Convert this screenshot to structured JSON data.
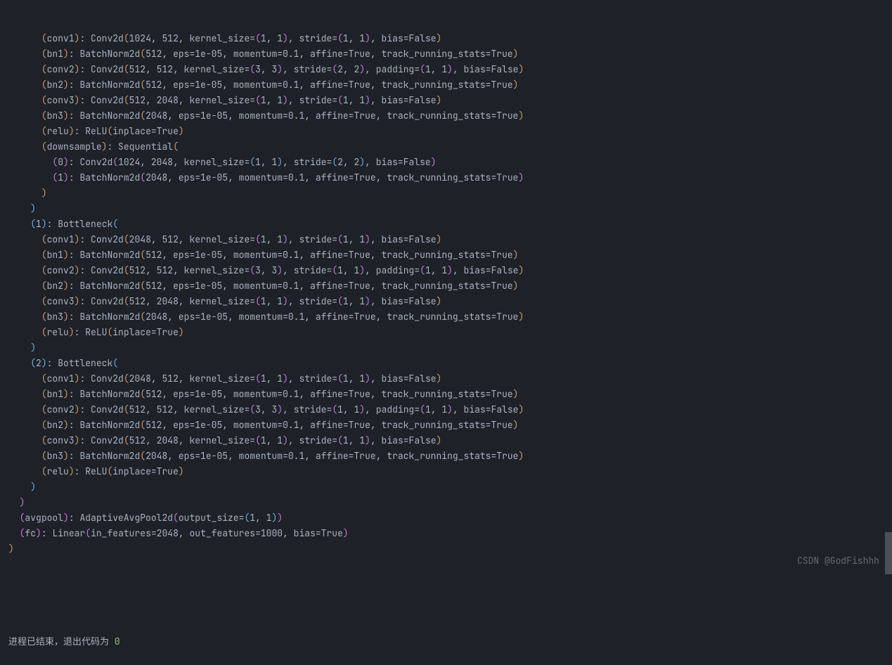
{
  "code_lines": [
    "      (conv1): Conv2d(1024, 512, kernel_size=(1, 1), stride=(1, 1), bias=False)",
    "      (bn1): BatchNorm2d(512, eps=1e-05, momentum=0.1, affine=True, track_running_stats=True)",
    "      (conv2): Conv2d(512, 512, kernel_size=(3, 3), stride=(2, 2), padding=(1, 1), bias=False)",
    "      (bn2): BatchNorm2d(512, eps=1e-05, momentum=0.1, affine=True, track_running_stats=True)",
    "      (conv3): Conv2d(512, 2048, kernel_size=(1, 1), stride=(1, 1), bias=False)",
    "      (bn3): BatchNorm2d(2048, eps=1e-05, momentum=0.1, affine=True, track_running_stats=True)",
    "      (relu): ReLU(inplace=True)",
    "      (downsample): Sequential(",
    "        (0): Conv2d(1024, 2048, kernel_size=(1, 1), stride=(2, 2), bias=False)",
    "        (1): BatchNorm2d(2048, eps=1e-05, momentum=0.1, affine=True, track_running_stats=True)",
    "      )",
    "    )",
    "    (1): Bottleneck(",
    "      (conv1): Conv2d(2048, 512, kernel_size=(1, 1), stride=(1, 1), bias=False)",
    "      (bn1): BatchNorm2d(512, eps=1e-05, momentum=0.1, affine=True, track_running_stats=True)",
    "      (conv2): Conv2d(512, 512, kernel_size=(3, 3), stride=(1, 1), padding=(1, 1), bias=False)",
    "      (bn2): BatchNorm2d(512, eps=1e-05, momentum=0.1, affine=True, track_running_stats=True)",
    "      (conv3): Conv2d(512, 2048, kernel_size=(1, 1), stride=(1, 1), bias=False)",
    "      (bn3): BatchNorm2d(2048, eps=1e-05, momentum=0.1, affine=True, track_running_stats=True)",
    "      (relu): ReLU(inplace=True)",
    "    )",
    "    (2): Bottleneck(",
    "      (conv1): Conv2d(2048, 512, kernel_size=(1, 1), stride=(1, 1), bias=False)",
    "      (bn1): BatchNorm2d(512, eps=1e-05, momentum=0.1, affine=True, track_running_stats=True)",
    "      (conv2): Conv2d(512, 512, kernel_size=(3, 3), stride=(1, 1), padding=(1, 1), bias=False)",
    "      (bn2): BatchNorm2d(512, eps=1e-05, momentum=0.1, affine=True, track_running_stats=True)",
    "      (conv3): Conv2d(512, 2048, kernel_size=(1, 1), stride=(1, 1), bias=False)",
    "      (bn3): BatchNorm2d(2048, eps=1e-05, momentum=0.1, affine=True, track_running_stats=True)",
    "      (relu): ReLU(inplace=True)",
    "    )",
    "  )",
    "  (avgpool): AdaptiveAvgPool2d(output_size=(1, 1))",
    "  (fc): Linear(in_features=2048, out_features=1000, bias=True)",
    ")"
  ],
  "exit_message_prefix": "进程已结束，退出代码为 ",
  "exit_code": "0",
  "watermark": "CSDN @GodFishhh"
}
